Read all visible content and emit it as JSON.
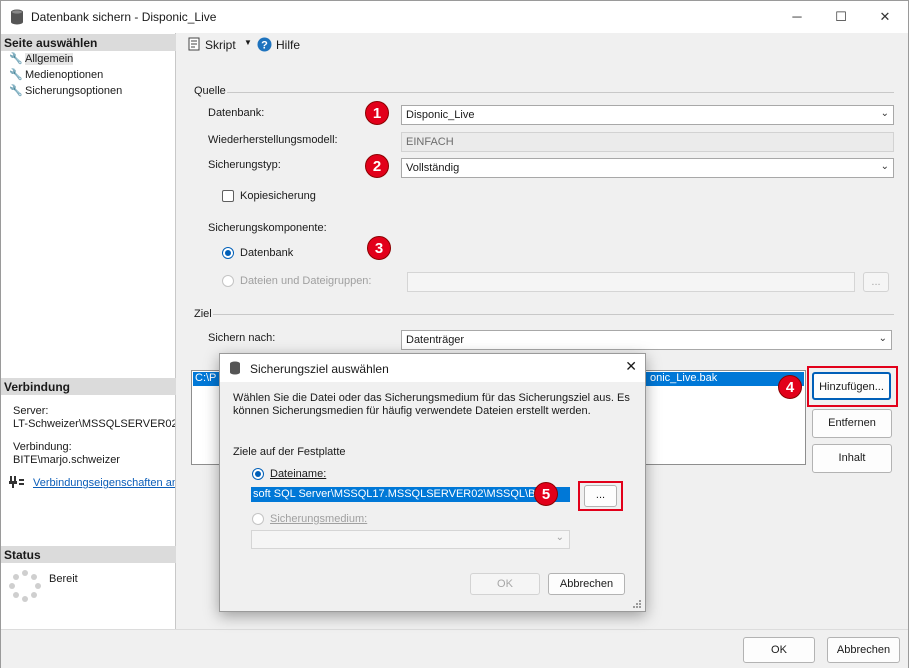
{
  "window": {
    "title": "Datenbank sichern - Disponic_Live",
    "controls": {
      "minimize": "─",
      "maximize": "☐",
      "close": "✕"
    }
  },
  "sidebar": {
    "select_page_heading": "Seite auswählen",
    "pages": [
      {
        "label": "Allgemein",
        "icon": "wrench-icon",
        "selected": true
      },
      {
        "label": "Medienoptionen",
        "icon": "wrench-icon",
        "selected": false
      },
      {
        "label": "Sicherungsoptionen",
        "icon": "wrench-icon",
        "selected": false
      }
    ],
    "connection_heading": "Verbindung",
    "server_label": "Server:",
    "server_value": "LT-Schweizer\\MSSQLSERVER02",
    "connection_label": "Verbindung:",
    "connection_value": "BITE\\marjo.schweizer",
    "connection_props_link": "Verbindungseigenschaften an",
    "status_heading": "Status",
    "status_value": "Bereit"
  },
  "toolbar": {
    "script_label": "Skript",
    "help_label": "Hilfe"
  },
  "source": {
    "group_title": "Quelle",
    "database_label": "Datenbank:",
    "database_value": "Disponic_Live",
    "recovery_label": "Wiederherstellungsmodell:",
    "recovery_value": "EINFACH",
    "backup_type_label": "Sicherungstyp:",
    "backup_type_value": "Vollständig",
    "copy_only_label": "Kopiesicherung",
    "component_label": "Sicherungskomponente:",
    "component_database": "Datenbank",
    "component_files": "Dateien und Dateigruppen:",
    "files_browse": "..."
  },
  "destination": {
    "group_title": "Ziel",
    "backup_to_label": "Sichern nach:",
    "backup_to_value": "Datenträger",
    "list_item_left": "C:\\P",
    "list_item_right": "onic_Live.bak",
    "add_button": "Hinzufügen...",
    "remove_button": "Entfernen",
    "contents_button": "Inhalt"
  },
  "footer": {
    "ok_button": "OK",
    "cancel_button": "Abbrechen"
  },
  "dialog": {
    "title": "Sicherungsziel auswählen",
    "close": "✕",
    "description": "Wählen Sie die Datei oder das Sicherungsmedium für das Sicherungsziel aus. Es können Sicherungsmedien für häufig verwendete Dateien erstellt werden.",
    "disk_targets_label": "Ziele auf der Festplatte",
    "filename_label": "Dateiname:",
    "filename_value": "soft SQL Server\\MSSQL17.MSSQLSERVER02\\MSSQL\\Ba",
    "browse_button": "...",
    "backup_device_label": "Sicherungsmedium:",
    "ok_button": "OK",
    "cancel_button": "Abbrechen"
  },
  "badges": [
    "1",
    "2",
    "3",
    "4",
    "5"
  ],
  "colors": {
    "badge_red": "#e2001a",
    "selection_blue": "#0078d7",
    "radio_blue": "#005fb8"
  }
}
